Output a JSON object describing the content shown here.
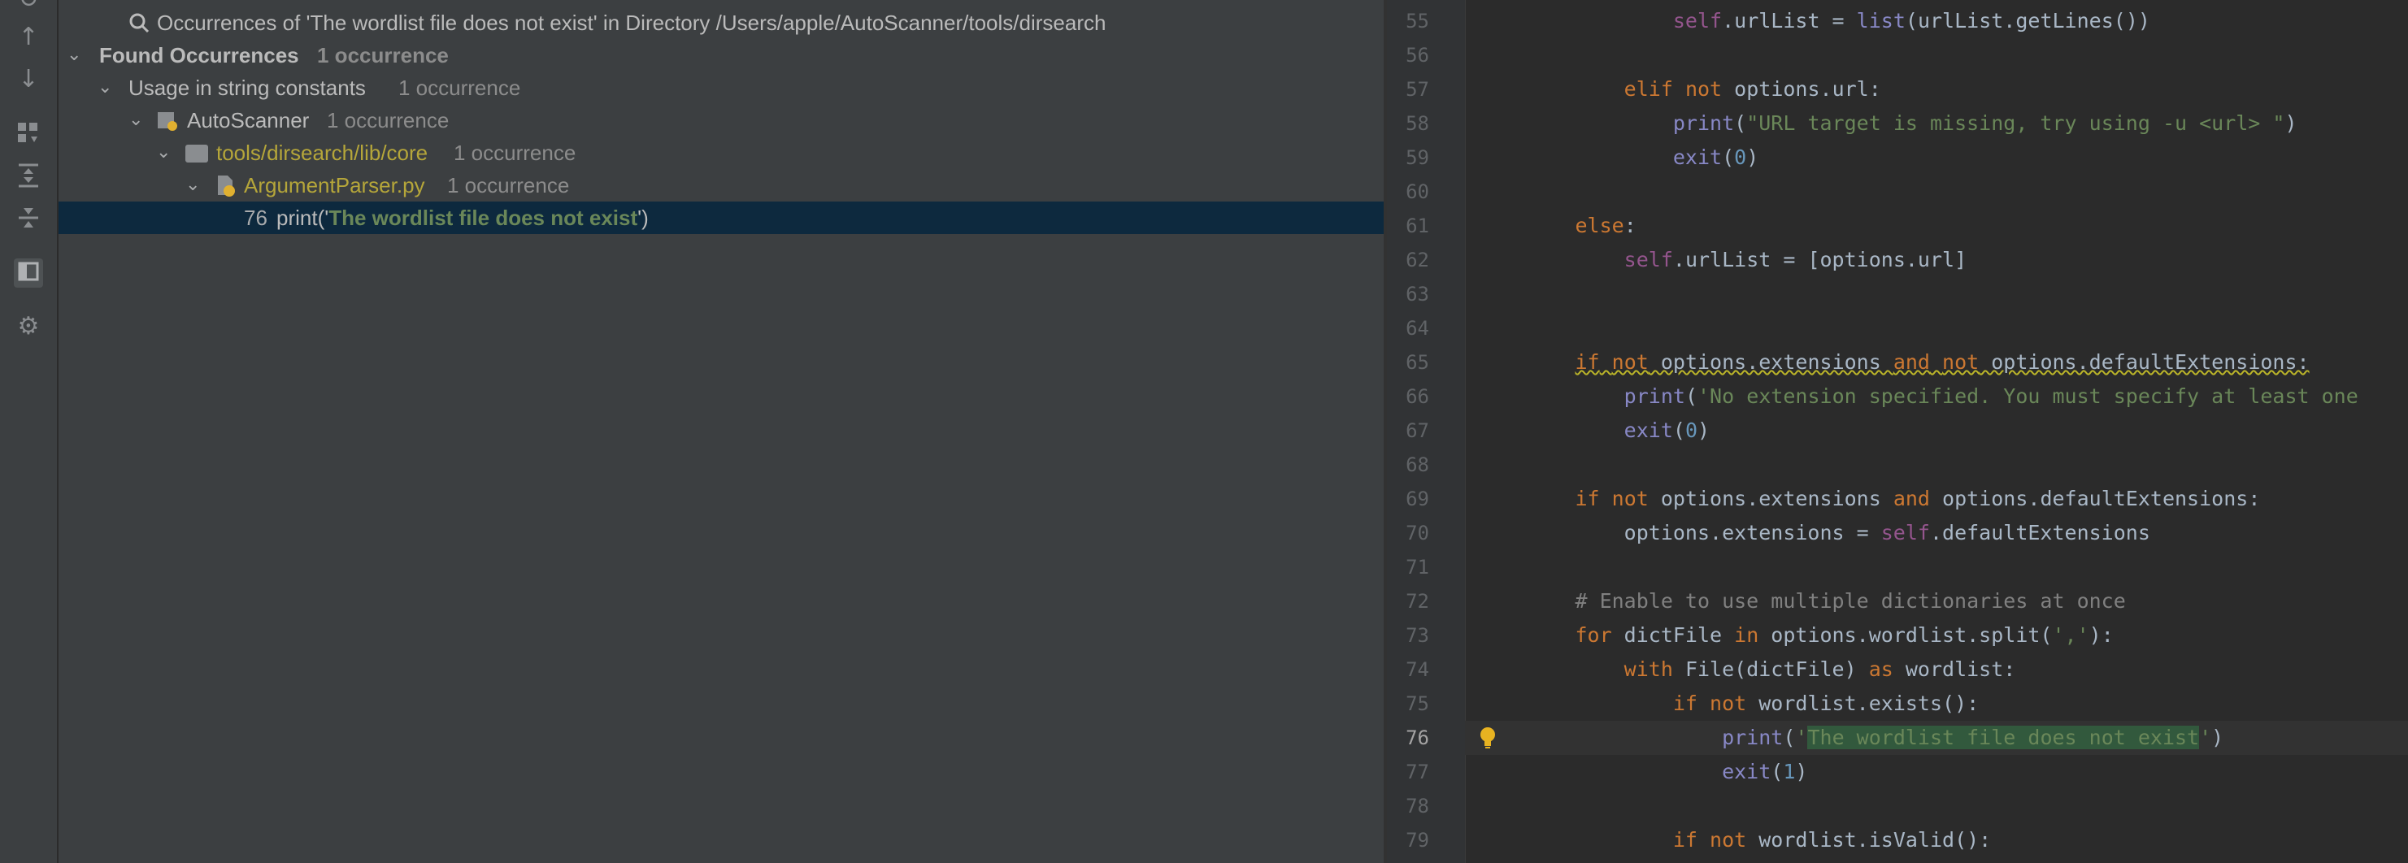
{
  "find_panel": {
    "query_row": "Occurrences of 'The wordlist file does not exist' in Directory /Users/apple/AutoScanner/tools/dirsearch",
    "found_label": "Found Occurrences",
    "found_count": "1 occurrence",
    "group_label": "Usage in string constants",
    "group_count": "1 occurrence",
    "project_label": "AutoScanner",
    "project_count": "1 occurrence",
    "dir_label": "tools/dirsearch/lib/core",
    "dir_count": "1 occurrence",
    "file_label": "ArgumentParser.py",
    "file_count": "1 occurrence",
    "result": {
      "line_no": "76",
      "prefix": "print('",
      "match": "The wordlist file does not exist",
      "suffix": "')"
    }
  },
  "toolbar": {
    "icons": [
      "rerun-icon",
      "up-arrow-icon",
      "down-arrow-icon",
      "group-by-icon",
      "expand-all-icon",
      "collapse-all-icon",
      "preview-icon",
      "settings-icon"
    ]
  },
  "editor": {
    "lines": [
      {
        "n": "55",
        "t": "                self.urlList = list(urlList.getLines())"
      },
      {
        "n": "56",
        "t": ""
      },
      {
        "n": "57",
        "t": "            elif not options.url:"
      },
      {
        "n": "58",
        "t": "                print(\"URL target is missing, try using -u <url> \")"
      },
      {
        "n": "59",
        "t": "                exit(0)"
      },
      {
        "n": "60",
        "t": ""
      },
      {
        "n": "61",
        "t": "        else:"
      },
      {
        "n": "62",
        "t": "            self.urlList = [options.url]"
      },
      {
        "n": "63",
        "t": ""
      },
      {
        "n": "64",
        "t": ""
      },
      {
        "n": "65",
        "t": "        if not options.extensions and not options.defaultExtensions:"
      },
      {
        "n": "66",
        "t": "            print('No extension specified. You must specify at least one"
      },
      {
        "n": "67",
        "t": "            exit(0)"
      },
      {
        "n": "68",
        "t": ""
      },
      {
        "n": "69",
        "t": "        if not options.extensions and options.defaultExtensions:"
      },
      {
        "n": "70",
        "t": "            options.extensions = self.defaultExtensions"
      },
      {
        "n": "71",
        "t": ""
      },
      {
        "n": "72",
        "t": "        # Enable to use multiple dictionaries at once"
      },
      {
        "n": "73",
        "t": "        for dictFile in options.wordlist.split(','):"
      },
      {
        "n": "74",
        "t": "            with File(dictFile) as wordlist:"
      },
      {
        "n": "75",
        "t": "                if not wordlist.exists():"
      },
      {
        "n": "76",
        "t": "                    print('The wordlist file does not exist')"
      },
      {
        "n": "77",
        "t": "                    exit(1)"
      },
      {
        "n": "78",
        "t": ""
      },
      {
        "n": "79",
        "t": "                if not wordlist.isValid():"
      }
    ],
    "current_line": "76"
  },
  "colors": {
    "panel_bg": "#3c3f41",
    "editor_bg": "#2b2b2b",
    "selected_row": "#0d293e",
    "keyword": "#cc7832",
    "string": "#6a8759"
  }
}
